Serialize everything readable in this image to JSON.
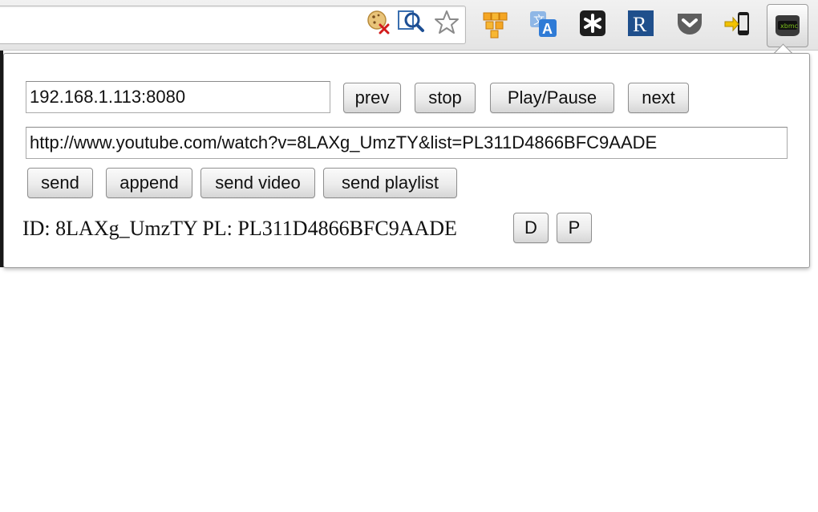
{
  "extensions": [
    {
      "icon": "cookie-remove-icon"
    },
    {
      "icon": "search-magnifier-icon"
    },
    {
      "icon": "bookmark-star-icon"
    },
    {
      "icon": "boxes-extension-icon"
    },
    {
      "icon": "translate-icon"
    },
    {
      "icon": "asterisk-extension-icon"
    },
    {
      "icon": "r-extension-icon",
      "label": "R"
    },
    {
      "icon": "pocket-icon"
    },
    {
      "icon": "send-to-phone-icon"
    },
    {
      "icon": "xbmc-remote-icon",
      "label": "xbmc"
    }
  ],
  "popup": {
    "host": "192.168.1.113:8080",
    "url": "http://www.youtube.com/watch?v=8LAXg_UmzTY&list=PL311D4866BFC9AADE",
    "controls": {
      "prev": "prev",
      "stop": "stop",
      "play_pause": "Play/Pause",
      "next": "next"
    },
    "actions": {
      "send": "send",
      "append": "append",
      "send_video": "send video",
      "send_playlist": "send playlist"
    },
    "ids": {
      "id_label": "ID:",
      "video_id": "8LAXg_UmzTY",
      "pl_label": "PL:",
      "playlist_id": "PL311D4866BFC9AADE",
      "d_button": "D",
      "p_button": "P"
    }
  },
  "colors": {
    "toolbar": "#e8e8e8",
    "popup_border": "#9a9a9a",
    "translate_blue": "#2f7bd6",
    "r_blue": "#1f4f8c",
    "xbmc_green": "#7fc31c"
  }
}
